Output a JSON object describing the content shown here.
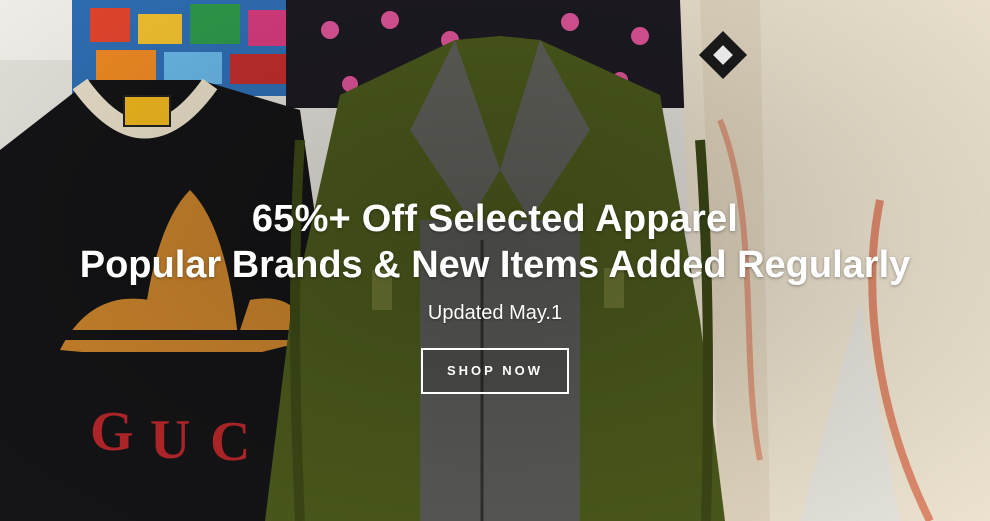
{
  "hero": {
    "headline": "65%+ Off Selected Apparel",
    "subline": "Popular Brands & New Items Added Regularly",
    "updated": "Updated May.1",
    "cta_label": "SHOP NOW",
    "images": {
      "tshirt": {
        "icon": "trefoil-icon",
        "print_text": "GUCCI",
        "colors": {
          "body": "#141416",
          "trefoil": "#c9832c",
          "print": "#b5262a",
          "collar": "#e9dfc9"
        }
      },
      "jacket": {
        "colors": {
          "velvet": "#4b5a1c",
          "lapel": "#5f605a"
        }
      },
      "pants": {
        "icon": "diamond-logo-icon",
        "colors": {
          "fabric": "#ece2cf",
          "stripe": "#d86b4a"
        }
      }
    }
  }
}
